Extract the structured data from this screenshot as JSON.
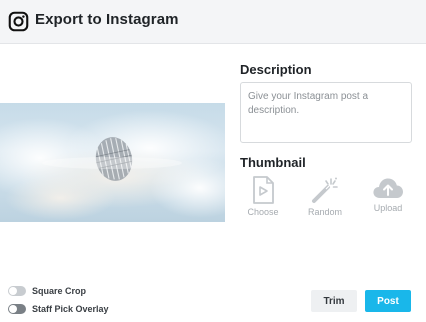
{
  "header": {
    "title": "Export to Instagram",
    "logo_icon": "instagram-icon"
  },
  "preview": {
    "image": "video-frame-clouds"
  },
  "description": {
    "heading": "Description",
    "placeholder": "Give your Instagram post a description.",
    "value": ""
  },
  "thumbnail": {
    "heading": "Thumbnail",
    "options": [
      {
        "label": "Choose",
        "icon": "video-file-icon"
      },
      {
        "label": "Random",
        "icon": "magic-wand-icon"
      },
      {
        "label": "Upload",
        "icon": "cloud-upload-icon"
      }
    ]
  },
  "options": {
    "square_crop_label": "Square Crop",
    "square_crop_on": false,
    "staff_pick_label": "Staff Pick Overlay",
    "staff_pick_on": true
  },
  "actions": {
    "trim_label": "Trim",
    "post_label": "Post"
  },
  "colors": {
    "accent": "#19b7ea",
    "header_bg": "#f4f5f7",
    "muted_icon": "#c5c9cd"
  }
}
